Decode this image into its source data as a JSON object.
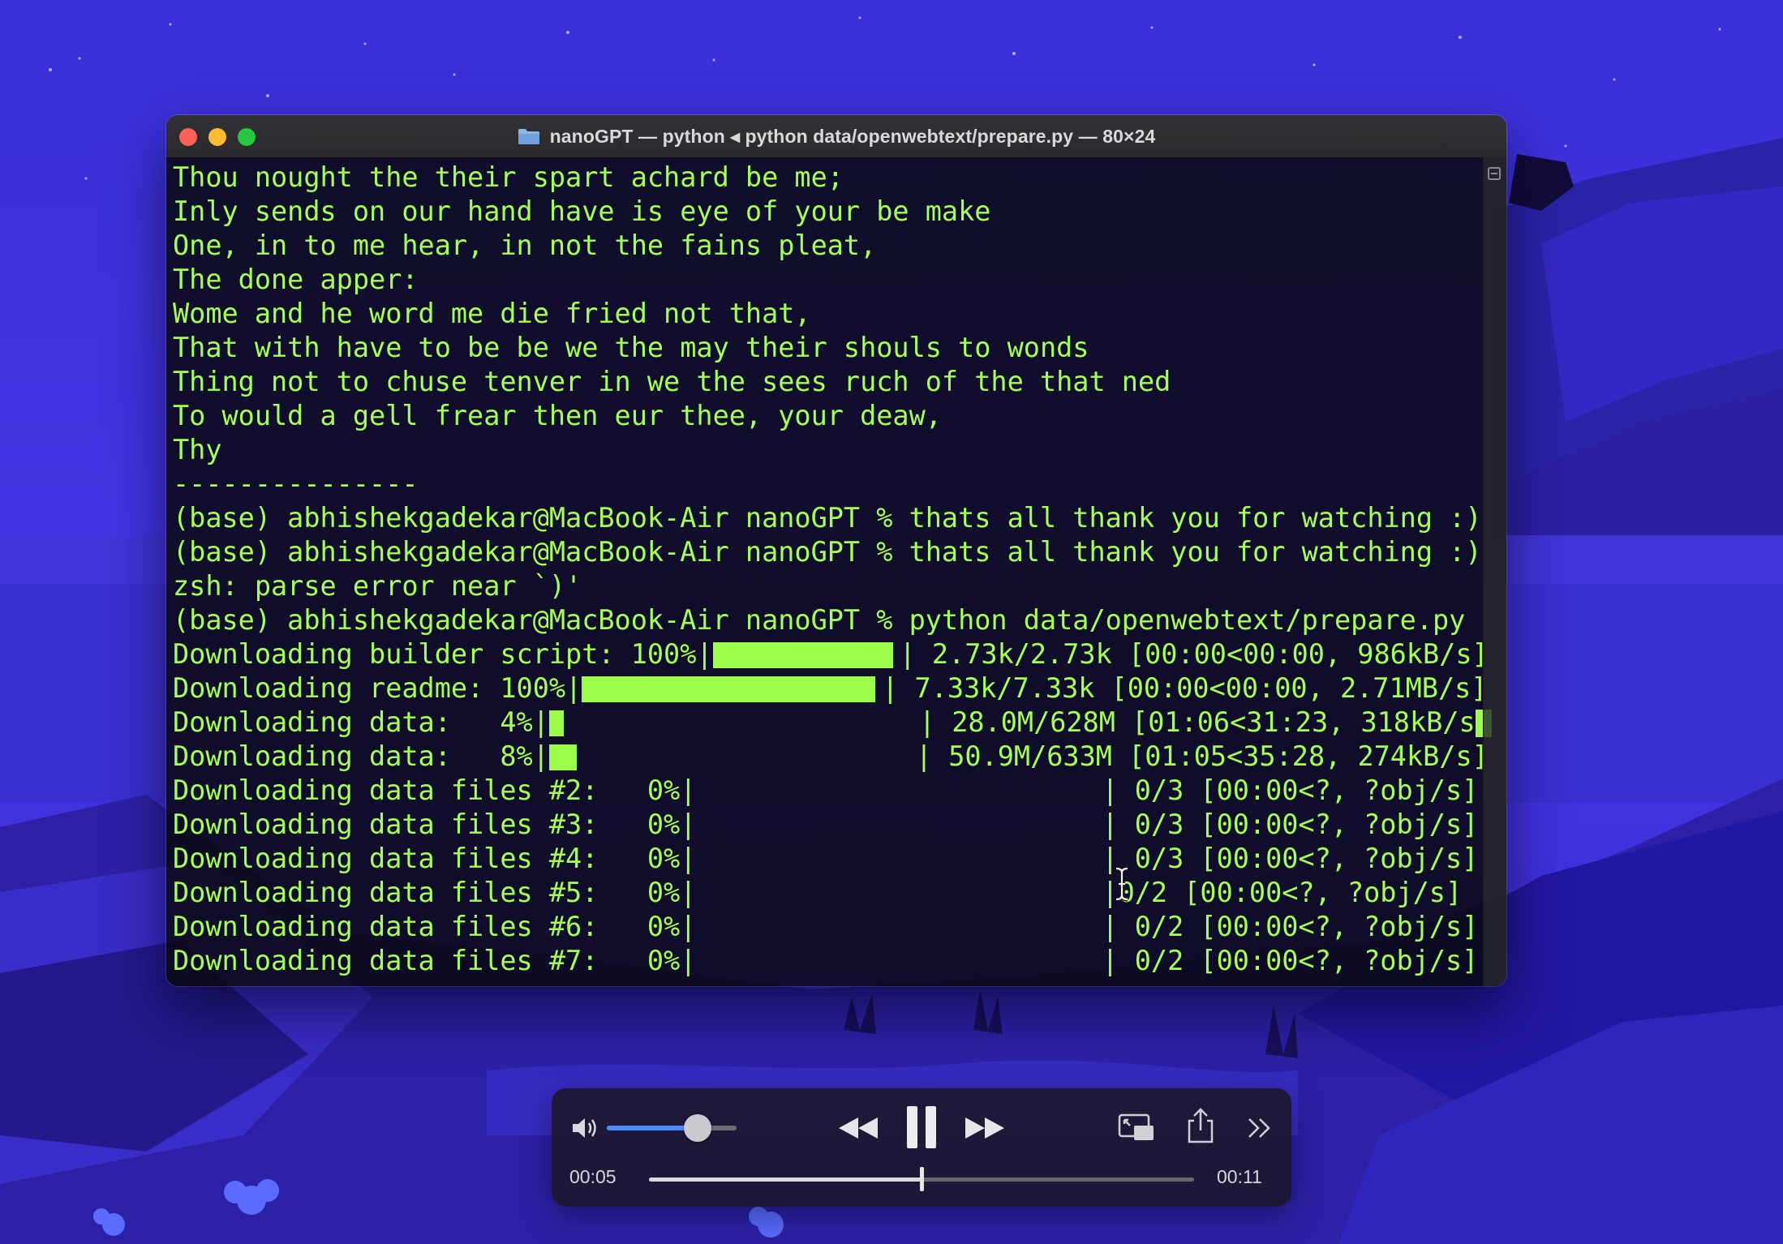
{
  "window": {
    "title": "nanoGPT — python ◂ python data/openwebtext/prepare.py — 80×24"
  },
  "terminal": {
    "text_color": "#a6ff55",
    "lines": [
      "Thou nought the their spart achard be me;",
      "Inly sends on our hand have is eye of your be make",
      "One, in to me hear, in not the fains pleat,",
      "The done apper:",
      "Wome and he word me die fried not that,",
      "That with have to be be we the may their shouls to wonds",
      "Thing not to chuse tenver in we the sees ruch of the that ned",
      "To would a gell frear then eur thee, your deaw,",
      "Thy",
      "---------------",
      "(base) abhishekgadekar@MacBook-Air nanoGPT % thats all thank you for watching :)",
      "(base) abhishekgadekar@MacBook-Air nanoGPT % thats all thank you for watching :)",
      "zsh: parse error near `)'",
      "(base) abhishekgadekar@MacBook-Air nanoGPT % python data/openwebtext/prepare.py"
    ],
    "progress": [
      {
        "label": "Downloading builder script: 100%|",
        "fraction": 1.0,
        "tail": "| 2.73k/2.73k [00:00<00:00, 986kB/s]"
      },
      {
        "label": "Downloading readme: 100%|",
        "fraction": 1.0,
        "tail": "| 7.33k/7.33k [00:00<00:00, 2.71MB/s]"
      },
      {
        "label": "Downloading data:   4%|",
        "fraction": 0.04,
        "tail": "| 28.0M/628M [01:06<31:23, 318kB/s"
      },
      {
        "label": "Downloading data:   8%|",
        "fraction": 0.08,
        "tail": "| 50.9M/633M [01:05<35:28, 274kB/s]"
      },
      {
        "label": "Downloading data files #2:   0%|",
        "fraction": 0,
        "tail": "| 0/3 [00:00<?, ?obj/s]"
      },
      {
        "label": "Downloading data files #3:   0%|",
        "fraction": 0,
        "tail": "| 0/3 [00:00<?, ?obj/s]"
      },
      {
        "label": "Downloading data files #4:   0%|",
        "fraction": 0,
        "tail": "| 0/3 [00:00<?, ?obj/s]"
      },
      {
        "label": "Downloading data files #5:   0%|",
        "fraction": 0,
        "tail": "|0/2 [00:00<?, ?obj/s]"
      },
      {
        "label": "Downloading data files #6:   0%|",
        "fraction": 0,
        "tail": "| 0/2 [00:00<?, ?obj/s]"
      },
      {
        "label": "Downloading data files #7:   0%|",
        "fraction": 0,
        "tail": "| 0/2 [00:00<?, ?obj/s]"
      }
    ]
  },
  "player": {
    "elapsed": "00:05",
    "duration": "00:11",
    "progress_fraction": 0.5,
    "volume_fraction": 0.7,
    "accent_color": "#4b8dff",
    "icons": [
      "speaker-icon",
      "rewind-icon",
      "pause-icon",
      "fast-forward-icon",
      "picture-in-picture-icon",
      "share-icon",
      "more-chevron-icon"
    ]
  }
}
